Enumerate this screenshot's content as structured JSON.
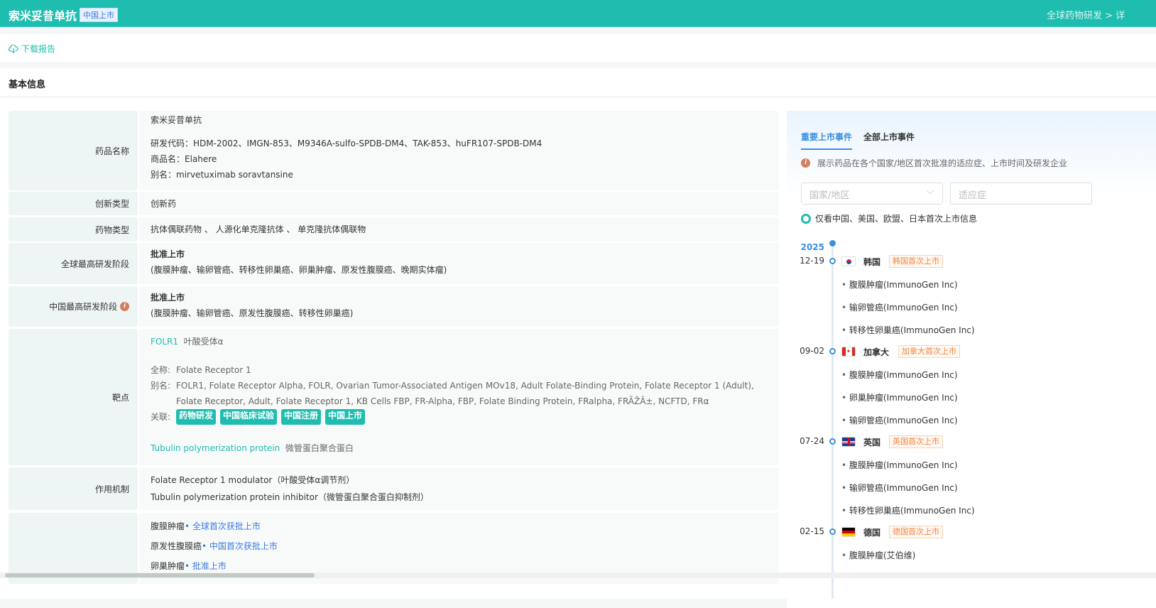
{
  "header": {
    "title": "索米妥昔单抗",
    "badge": "中国上市",
    "breadcrumb": "全球药物研发 > 详"
  },
  "toolbar": {
    "download": "下载报告"
  },
  "section_title": "基本信息",
  "rows": {
    "name": {
      "label": "药品名称",
      "cn": "索米妥昔单抗",
      "codes": "研发代码：HDM-2002、IMGN-853、M9346A-sulfo-SPDB-DM4、TAK-853、huFR107-SPDB-DM4",
      "trade": "商品名：Elahere",
      "alias": "别名：mirvetuximab soravtansine"
    },
    "innov": {
      "label": "创新类型",
      "value": "创新药"
    },
    "type": {
      "label": "药物类型",
      "value": "抗体偶联药物 、 人源化单克隆抗体 、 单克隆抗体偶联物"
    },
    "global": {
      "label": "全球最高研发阶段",
      "stage": "批准上市",
      "ind": "(腹膜肿瘤、输卵管癌、转移性卵巢癌、卵巢肿瘤、原发性腹膜癌、晚期实体瘤)"
    },
    "china": {
      "label": "中国最高研发阶段",
      "stage": "批准上市",
      "ind": "(腹膜肿瘤、输卵管癌、原发性腹膜癌、转移性卵巢癌)"
    },
    "target": {
      "label": "靶点",
      "t1": "FOLR1",
      "t1cn": "叶酸受体α",
      "full_label": "全称:",
      "full": "Folate Receptor 1",
      "alias_label": "别名:",
      "alias": "FOLR1, Folate Receptor Alpha, FOLR, Ovarian Tumor-Associated Antigen MOv18, Adult Folate-Binding Protein, Folate Receptor 1 (Adult), Folate Receptor, Adult, Folate Receptor 1, KB Cells FBP, FR-Alpha, FBP, Folate Binding Protein, FRalpha, FRÃŽÂ±, NCFTD, FRα",
      "rel_label": "关联:",
      "tags": [
        "药物研发",
        "中国临床试验",
        "中国注册",
        "中国上市"
      ],
      "t2": "Tubulin polymerization protein",
      "t2cn": "微管蛋白聚合蛋白"
    },
    "moa": {
      "label": "作用机制",
      "m1": "Folate Receptor 1 modulator（叶酸受体α调节剂）",
      "m2": "Tubulin polymerization protein inhibitor（微管蛋白聚合蛋白抑制剂）"
    },
    "ind": {
      "items": [
        {
          "name": "腹膜肿瘤",
          "status": "• 全球首次获批上市"
        },
        {
          "name": "原发性腹膜癌",
          "status": "• 中国首次获批上市"
        },
        {
          "name": "卵巢肿瘤",
          "status": "• 批准上市"
        }
      ]
    }
  },
  "panel": {
    "tabs": [
      "重要上市事件",
      "全部上市事件"
    ],
    "note": "展示药品在各个国家/地区首次批准的适应症、上市时间及研发企业",
    "country_placeholder": "国家/地区",
    "ind_placeholder": "适应症",
    "only": "仅看中国、美国、欧盟、日本首次上市信息",
    "year": "2025",
    "events": [
      {
        "date": "12-19",
        "country": "韩国",
        "badge": "韩国首次上市",
        "flag": "kr",
        "items": [
          "腹膜肿瘤(ImmunoGen Inc)",
          "输卵管癌(ImmunoGen Inc)",
          "转移性卵巢癌(ImmunoGen Inc)"
        ]
      },
      {
        "date": "09-02",
        "country": "加拿大",
        "badge": "加拿大首次上市",
        "flag": "ca",
        "items": [
          "腹膜肿瘤(ImmunoGen Inc)",
          "卵巢肿瘤(ImmunoGen Inc)",
          "输卵管癌(ImmunoGen Inc)"
        ]
      },
      {
        "date": "07-24",
        "country": "英国",
        "badge": "英国首次上市",
        "flag": "gb",
        "items": [
          "腹膜肿瘤(ImmunoGen Inc)",
          "输卵管癌(ImmunoGen Inc)",
          "转移性卵巢癌(ImmunoGen Inc)"
        ]
      },
      {
        "date": "02-15",
        "country": "德国",
        "badge": "德国首次上市",
        "flag": "de",
        "items": [
          "腹膜肿瘤(艾伯维)"
        ]
      }
    ]
  },
  "colors": {
    "brand": "#1fbdb0",
    "accent": "#3a8fe0",
    "badge": "#f5843c"
  }
}
